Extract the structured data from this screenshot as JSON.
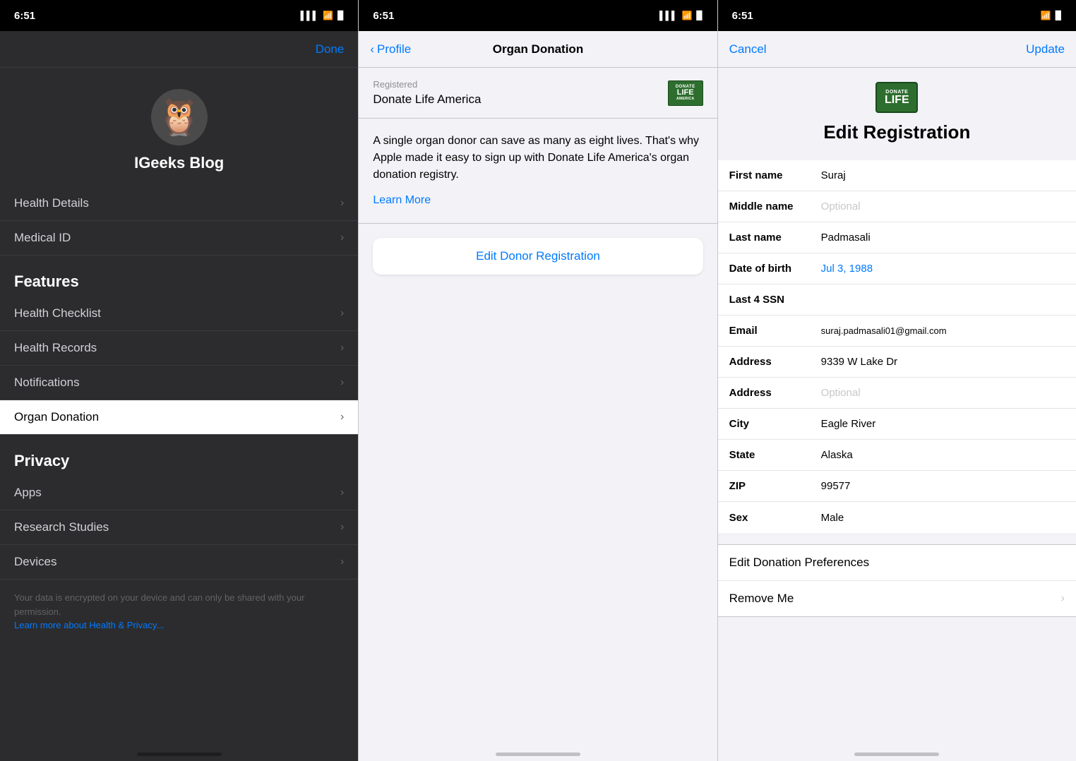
{
  "panel1": {
    "statusBar": {
      "time": "6:51",
      "signal": "▌▌▌",
      "wifi": "WiFi",
      "battery": "🔋"
    },
    "navBar": {
      "doneLabel": "Done"
    },
    "profile": {
      "avatarEmoji": "🦉",
      "name": "IGeeks Blog"
    },
    "topMenuItems": [
      {
        "label": "Health Details",
        "hasChevron": true
      },
      {
        "label": "Medical ID",
        "hasChevron": true
      }
    ],
    "featuresHeader": "Features",
    "featuresItems": [
      {
        "label": "Health Checklist",
        "hasChevron": true
      },
      {
        "label": "Health Records",
        "hasChevron": true
      },
      {
        "label": "Notifications",
        "hasChevron": true
      },
      {
        "label": "Organ Donation",
        "hasChevron": true,
        "active": true
      }
    ],
    "privacyHeader": "Privacy",
    "privacyItems": [
      {
        "label": "Apps",
        "hasChevron": true
      },
      {
        "label": "Research Studies",
        "hasChevron": true
      },
      {
        "label": "Devices",
        "hasChevron": true
      }
    ],
    "footerText": "Your data is encrypted on your device and can only be shared with your permission.",
    "footerLinkText": "Learn more about Health & Privacy..."
  },
  "panel2": {
    "statusBar": {
      "time": "6:51"
    },
    "navBar": {
      "backLabel": "Profile",
      "title": "Organ Donation"
    },
    "registeredLabel": "Registered",
    "registeredName": "Donate Life America",
    "logoTopText": "DONATE",
    "logoBottomText": "LIFE",
    "description": "A single organ donor can save as many as eight lives. That's why Apple made it easy to sign up with Donate Life America's organ donation registry.",
    "learnMoreLabel": "Learn More",
    "editDonorLabel": "Edit Donor Registration"
  },
  "panel3": {
    "statusBar": {
      "time": "6:51"
    },
    "navBar": {
      "cancelLabel": "Cancel",
      "updateLabel": "Update"
    },
    "logoTopText": "DONATE",
    "logoWord": "LIFE",
    "pageTitle": "Edit Registration",
    "formRows": [
      {
        "label": "First name",
        "value": "Suraj",
        "isPlaceholder": false,
        "isBlue": false
      },
      {
        "label": "Middle name",
        "value": "Optional",
        "isPlaceholder": true,
        "isBlue": false
      },
      {
        "label": "Last name",
        "value": "Padmasali",
        "isPlaceholder": false,
        "isBlue": false
      },
      {
        "label": "Date of birth",
        "value": "Jul 3, 1988",
        "isPlaceholder": false,
        "isBlue": true
      },
      {
        "label": "Last 4 SSN",
        "value": "",
        "isPlaceholder": false,
        "isBlue": false
      },
      {
        "label": "Email",
        "value": "suraj.padmasali01@gmail.com",
        "isPlaceholder": false,
        "isBlue": false
      },
      {
        "label": "Address",
        "value": "9339 W Lake Dr",
        "isPlaceholder": false,
        "isBlue": false
      },
      {
        "label": "Address",
        "value": "Optional",
        "isPlaceholder": true,
        "isBlue": false
      },
      {
        "label": "City",
        "value": "Eagle River",
        "isPlaceholder": false,
        "isBlue": false
      },
      {
        "label": "State",
        "value": "Alaska",
        "isPlaceholder": false,
        "isBlue": false
      },
      {
        "label": "ZIP",
        "value": "99577",
        "isPlaceholder": false,
        "isBlue": false
      },
      {
        "label": "Sex",
        "value": "Male",
        "isPlaceholder": false,
        "isBlue": false
      }
    ],
    "actionRows": [
      {
        "label": "Edit Donation Preferences",
        "hasChevron": false
      },
      {
        "label": "Remove Me",
        "hasChevron": true
      }
    ]
  }
}
